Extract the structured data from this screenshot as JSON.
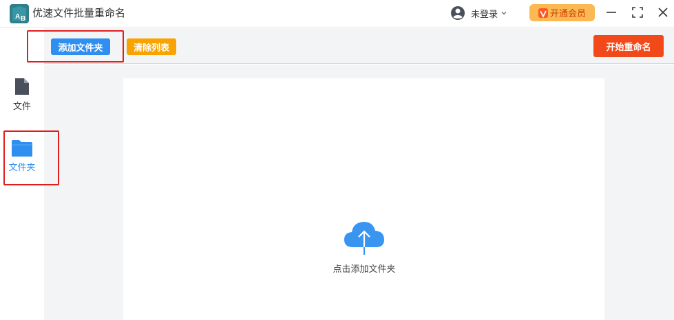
{
  "app": {
    "title": "优速文件批量重命名",
    "logo_text_a": "A",
    "logo_text_b": "B"
  },
  "user": {
    "label": "未登录"
  },
  "vip": {
    "label": "开通会员",
    "badge_glyph": "V"
  },
  "toolbar": {
    "add_folder_label": "添加文件夹",
    "clear_list_label": "清除列表",
    "start_rename_label": "开始重命名"
  },
  "sidebar": {
    "items": [
      {
        "label": "文件",
        "icon": "file-icon",
        "active": false
      },
      {
        "label": "文件夹",
        "icon": "folder-icon",
        "active": true
      }
    ]
  },
  "dropzone": {
    "label": "点击添加文件夹",
    "icon": "cloud-upload-icon"
  },
  "colors": {
    "primary": "#2f8ff0",
    "warning": "#f9a300",
    "danger": "#f2491b",
    "vip": "#fbb954",
    "highlight": "#e21d1d"
  }
}
